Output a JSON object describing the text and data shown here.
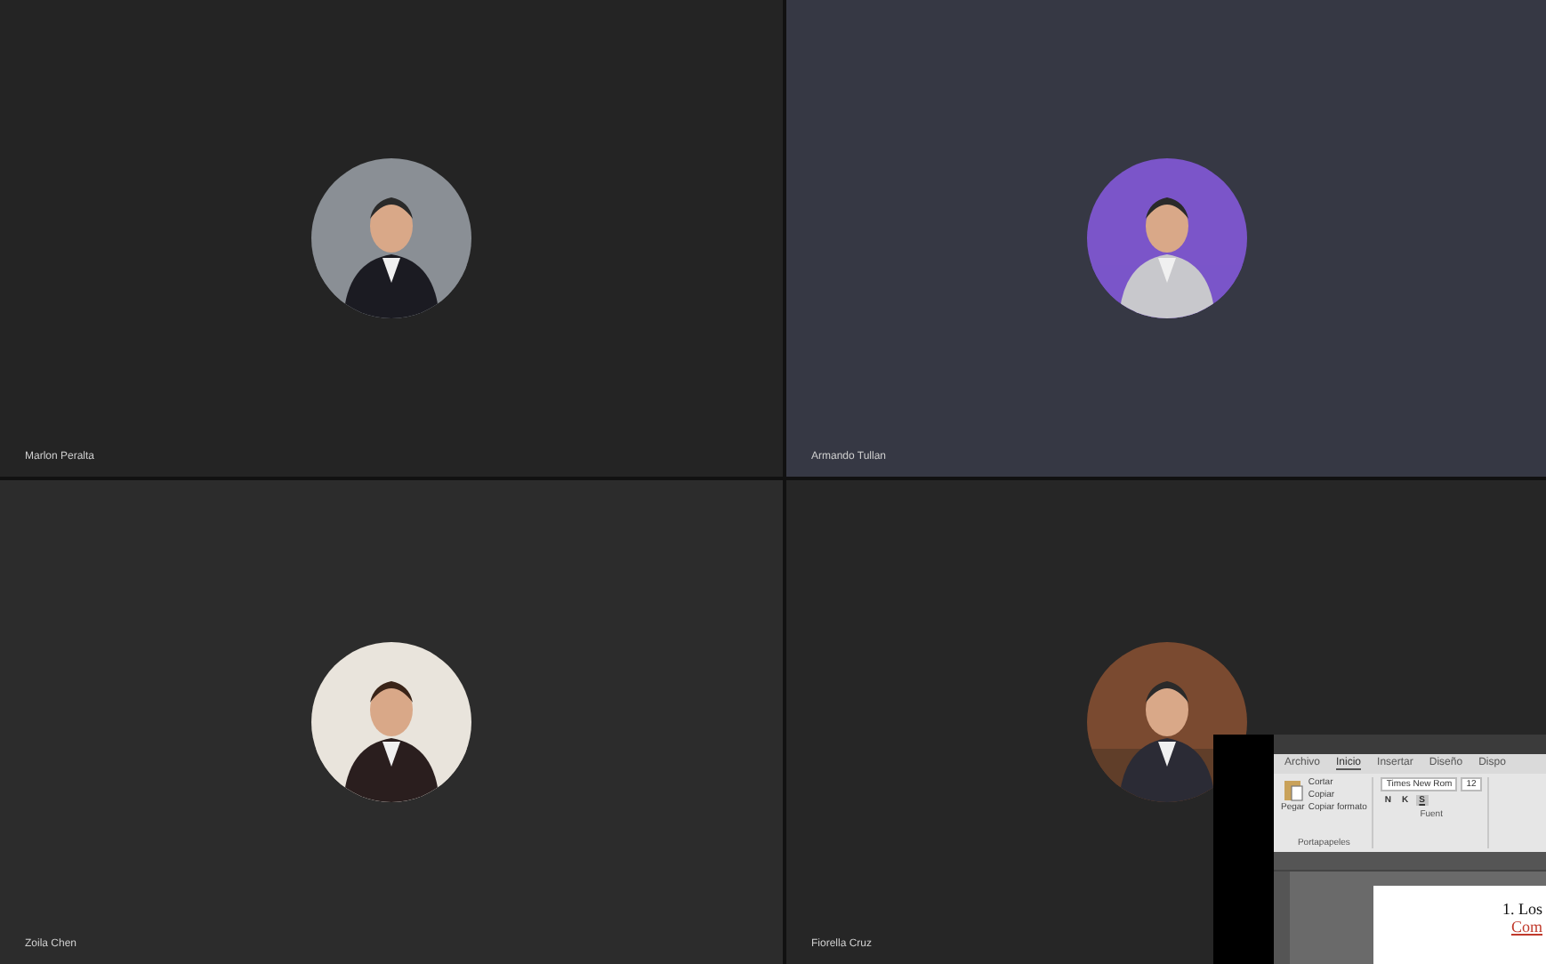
{
  "participants": [
    {
      "name": "Marlon Peralta"
    },
    {
      "name": "Armando Tullan"
    },
    {
      "name": "Zoila Chen"
    },
    {
      "name": "Fiorella Cruz"
    }
  ],
  "shared_window": {
    "tabs": [
      {
        "label": "Archivo",
        "selected": false
      },
      {
        "label": "Inicio",
        "selected": true
      },
      {
        "label": "Insertar",
        "selected": false
      },
      {
        "label": "Diseño",
        "selected": false
      },
      {
        "label": "Dispo",
        "selected": false
      }
    ],
    "clipboard": {
      "paste": "Pegar",
      "items": [
        "Cortar",
        "Copiar",
        "Copiar formato"
      ],
      "group": "Portapapeles"
    },
    "font": {
      "name": "Times New Rom",
      "size": "12",
      "buttons": [
        "N",
        "K",
        "S"
      ],
      "group": "Fuent"
    },
    "document": {
      "lines": [
        {
          "text": "1. Los",
          "kind": "plain"
        },
        {
          "text": "Com",
          "kind": "link"
        }
      ]
    }
  }
}
